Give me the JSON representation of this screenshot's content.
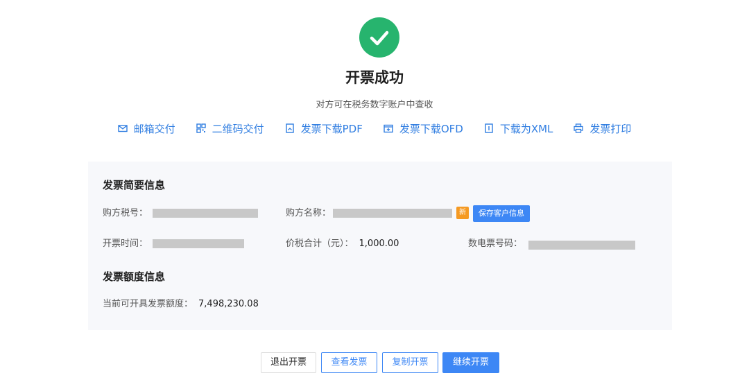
{
  "header": {
    "title": "开票成功",
    "subtitle": "对方可在税务数字账户中查收"
  },
  "actions": [
    {
      "label": "邮箱交付",
      "icon": "mail-icon"
    },
    {
      "label": "二维码交付",
      "icon": "qrcode-icon"
    },
    {
      "label": "发票下载PDF",
      "icon": "pdf-download-icon"
    },
    {
      "label": "发票下载OFD",
      "icon": "ofd-download-icon"
    },
    {
      "label": "下载为XML",
      "icon": "xml-download-icon"
    },
    {
      "label": "发票打印",
      "icon": "printer-icon"
    }
  ],
  "summary": {
    "title": "发票简要信息",
    "buyer_tax_no_label": "购方税号：",
    "buyer_name_label": "购方名称：",
    "new_badge": "新",
    "save_customer_label": "保存客户信息",
    "issue_time_label": "开票时间：",
    "total_label": "价税合计（元）：",
    "total_value": "1,000.00",
    "invoice_no_label": "数电票号码："
  },
  "quota": {
    "title": "发票额度信息",
    "available_label": "当前可开具发票额度：",
    "available_value": "7,498,230.08"
  },
  "buttons": {
    "exit": "退出开票",
    "view": "查看发票",
    "copy": "复制开票",
    "continue": "继续开票"
  },
  "colors": {
    "success": "#27b46e",
    "link": "#2f7de1",
    "primary": "#3d87f5",
    "badge": "#f59a23",
    "panel_bg": "#f7f8fb"
  }
}
